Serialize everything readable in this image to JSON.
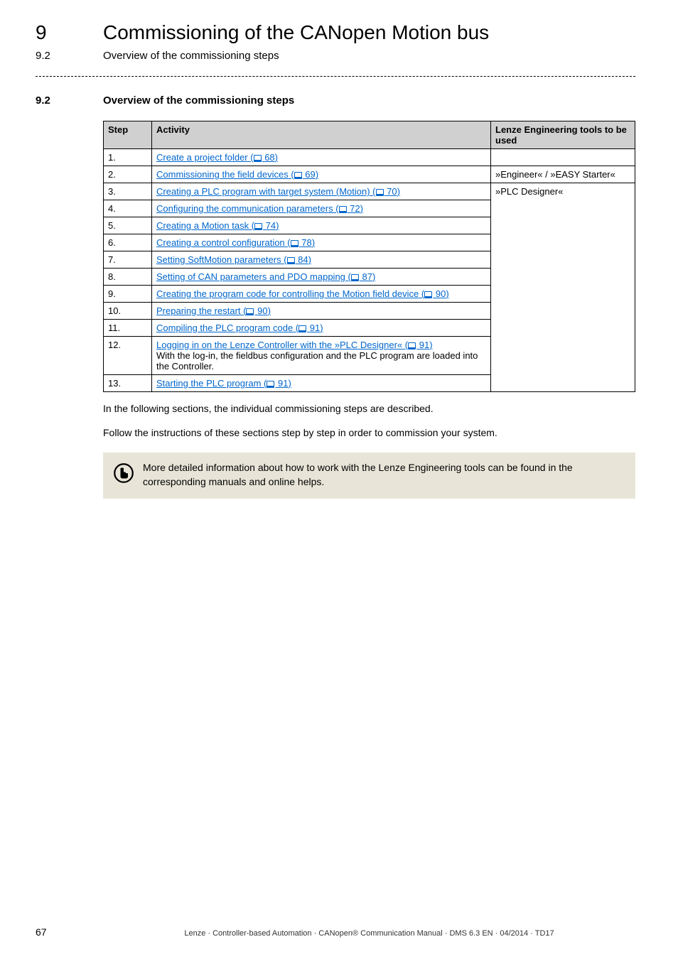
{
  "header": {
    "chapterNum": "9",
    "chapterTitle": "Commissioning of the CANopen Motion bus",
    "subNum": "9.2",
    "subTitle": "Overview of the commissioning steps"
  },
  "section": {
    "num": "9.2",
    "title": "Overview of the commissioning steps"
  },
  "table": {
    "headers": {
      "step": "Step",
      "activity": "Activity",
      "tools": "Lenze Engineering tools to be used"
    },
    "rows": [
      {
        "step": "1.",
        "activity": "Create a project folder",
        "ref": "68",
        "tools": ""
      },
      {
        "step": "2.",
        "activity": "Commissioning the field devices",
        "ref": "69",
        "tools": "»Engineer« / »EASY Starter«"
      },
      {
        "step": "3.",
        "activity": "Creating a PLC program with target system (Motion)",
        "ref": "70",
        "tools": "»PLC Designer«"
      },
      {
        "step": "4.",
        "activity": "Configuring the communication parameters",
        "ref": "72",
        "tools": ""
      },
      {
        "step": "5.",
        "activity": "Creating a Motion task",
        "ref": "74",
        "tools": ""
      },
      {
        "step": "6.",
        "activity": "Creating a control configuration",
        "ref": "78",
        "tools": ""
      },
      {
        "step": "7.",
        "activity": "Setting SoftMotion parameters",
        "ref": "84",
        "tools": ""
      },
      {
        "step": "8.",
        "activity": "Setting of CAN parameters and PDO mapping",
        "ref": "87",
        "tools": ""
      },
      {
        "step": "9.",
        "activity": "Creating the program code for controlling the Motion field device",
        "ref": "90",
        "tools": ""
      },
      {
        "step": "10.",
        "activity": "Preparing the restart",
        "ref": "90",
        "tools": ""
      },
      {
        "step": "11.",
        "activity": "Compiling the PLC program code",
        "ref": "91",
        "tools": ""
      },
      {
        "step": "12.",
        "activity": "Logging in on the Lenze Controller with the »PLC Designer«",
        "ref": "91",
        "extra": "With the log-in, the fieldbus configuration and the PLC program are loaded into the Controller.",
        "tools": ""
      },
      {
        "step": "13.",
        "activity": "Starting the PLC program",
        "ref": "91",
        "tools": ""
      }
    ]
  },
  "paragraphs": {
    "p1": "In the following sections, the individual commissioning steps are described.",
    "p2": "Follow the instructions of these sections step by step in order to commission your system."
  },
  "note": "More detailed information about how to work with the Lenze Engineering tools can be found in the corresponding manuals and online helps.",
  "footer": {
    "page": "67",
    "text": "Lenze · Controller-based Automation · CANopen® Communication Manual · DMS 6.3 EN · 04/2014 · TD17"
  }
}
